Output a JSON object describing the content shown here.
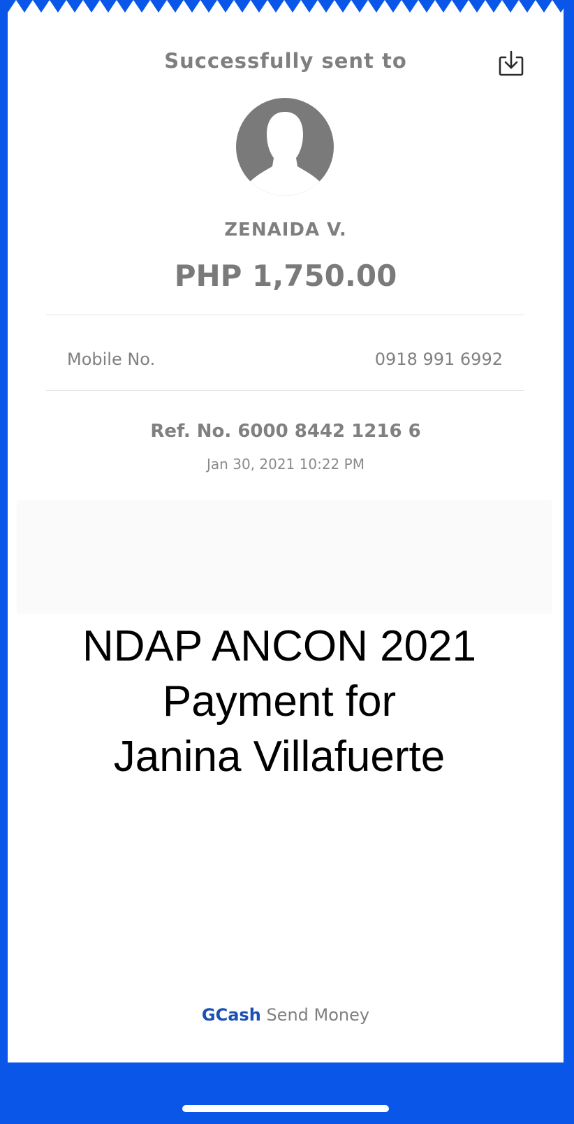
{
  "receipt": {
    "title": "Successfully sent to",
    "recipient_name": "ZENAIDA V.",
    "amount": "PHP 1,750.00",
    "mobile_label": "Mobile No.",
    "mobile_value": "0918 991 6992",
    "ref_no": "Ref. No. 6000 8442 1216 6",
    "timestamp": "Jan 30, 2021 10:22 PM",
    "message_lines": [
      "NDAP ANCON 2021",
      "Payment for",
      "Janina Villafuerte"
    ],
    "footer_brand": "GCash",
    "footer_text": "Send Money"
  },
  "icons": {
    "download": "download-icon",
    "avatar": "default-user-avatar"
  },
  "colors": {
    "background": "#0a56e8",
    "brand": "#1a4fb4",
    "text_gray": "#808080"
  }
}
